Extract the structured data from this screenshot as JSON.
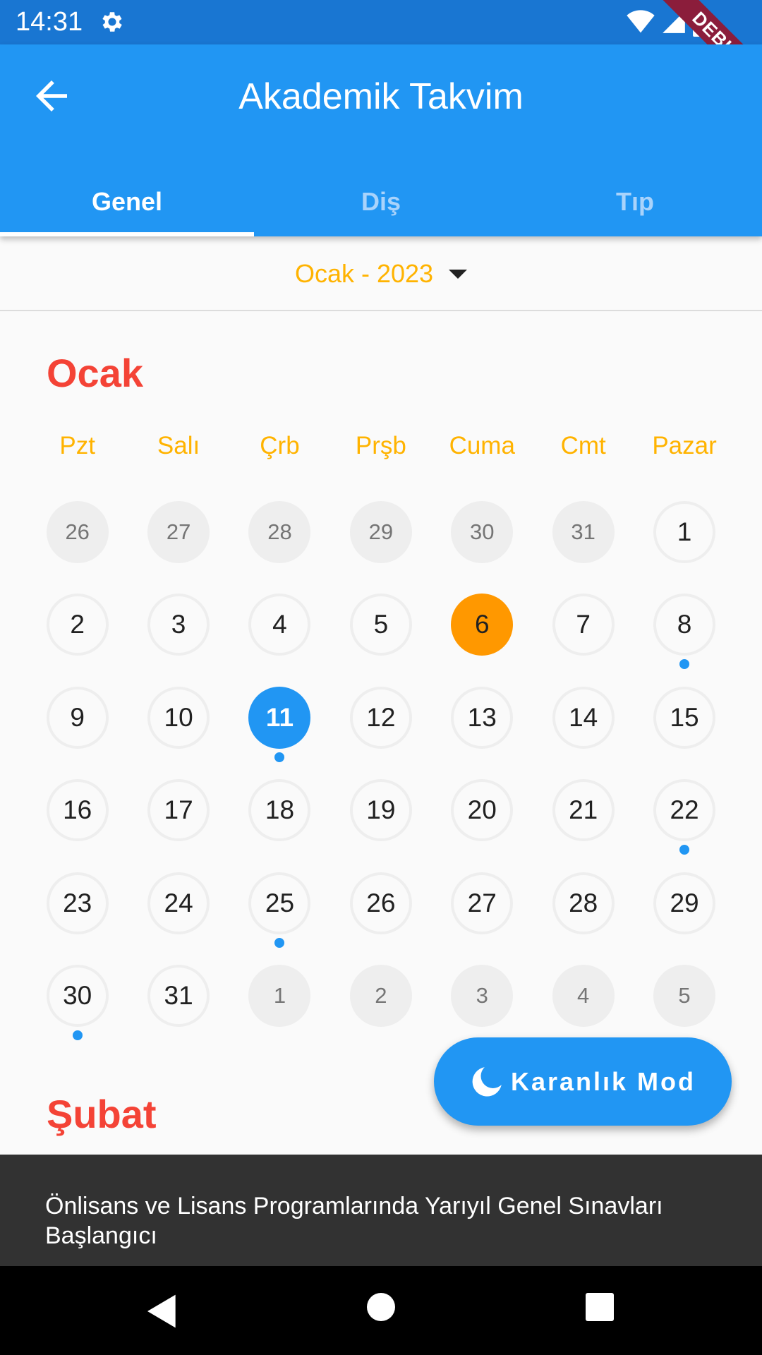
{
  "status_bar": {
    "time": "14:31",
    "debug_label": "DEBUG"
  },
  "app_bar": {
    "title": "Akademik Takvim"
  },
  "tabs": [
    {
      "label": "Genel",
      "active": true
    },
    {
      "label": "Diş",
      "active": false
    },
    {
      "label": "Tıp",
      "active": false
    }
  ],
  "month_selector": {
    "label": "Ocak - 2023"
  },
  "calendar": {
    "month_title": "Ocak",
    "weekdays": [
      "Pzt",
      "Salı",
      "Çrb",
      "Prşb",
      "Cuma",
      "Cmt",
      "Pazar"
    ],
    "weeks": [
      [
        {
          "d": "26",
          "type": "other"
        },
        {
          "d": "27",
          "type": "other"
        },
        {
          "d": "28",
          "type": "other"
        },
        {
          "d": "29",
          "type": "other"
        },
        {
          "d": "30",
          "type": "other"
        },
        {
          "d": "31",
          "type": "other"
        },
        {
          "d": "1",
          "type": "cur"
        }
      ],
      [
        {
          "d": "2",
          "type": "cur"
        },
        {
          "d": "3",
          "type": "cur"
        },
        {
          "d": "4",
          "type": "cur"
        },
        {
          "d": "5",
          "type": "cur"
        },
        {
          "d": "6",
          "type": "today"
        },
        {
          "d": "7",
          "type": "cur"
        },
        {
          "d": "8",
          "type": "cur",
          "event": true
        }
      ],
      [
        {
          "d": "9",
          "type": "cur"
        },
        {
          "d": "10",
          "type": "cur"
        },
        {
          "d": "11",
          "type": "selected",
          "event": true
        },
        {
          "d": "12",
          "type": "cur"
        },
        {
          "d": "13",
          "type": "cur"
        },
        {
          "d": "14",
          "type": "cur"
        },
        {
          "d": "15",
          "type": "cur"
        }
      ],
      [
        {
          "d": "16",
          "type": "cur"
        },
        {
          "d": "17",
          "type": "cur"
        },
        {
          "d": "18",
          "type": "cur"
        },
        {
          "d": "19",
          "type": "cur"
        },
        {
          "d": "20",
          "type": "cur"
        },
        {
          "d": "21",
          "type": "cur"
        },
        {
          "d": "22",
          "type": "cur",
          "event": true
        }
      ],
      [
        {
          "d": "23",
          "type": "cur"
        },
        {
          "d": "24",
          "type": "cur"
        },
        {
          "d": "25",
          "type": "cur",
          "event": true
        },
        {
          "d": "26",
          "type": "cur"
        },
        {
          "d": "27",
          "type": "cur"
        },
        {
          "d": "28",
          "type": "cur"
        },
        {
          "d": "29",
          "type": "cur"
        }
      ],
      [
        {
          "d": "30",
          "type": "cur",
          "event": true
        },
        {
          "d": "31",
          "type": "cur"
        },
        {
          "d": "1",
          "type": "other"
        },
        {
          "d": "2",
          "type": "other"
        },
        {
          "d": "3",
          "type": "other"
        },
        {
          "d": "4",
          "type": "other"
        },
        {
          "d": "5",
          "type": "other"
        }
      ]
    ],
    "next_month_title": "Şubat"
  },
  "fab": {
    "label": "Karanlık Mod",
    "icon": "moon-icon"
  },
  "snackbar": {
    "text": "Önlisans ve Lisans Programlarında Yarıyıl Genel Sınavları Başlangıcı"
  },
  "colors": {
    "primary": "#2196f3",
    "status_bar": "#1976d2",
    "accent": "#ffb300",
    "month_title": "#f44336",
    "today": "#ff9800",
    "snackbar": "#323232"
  }
}
